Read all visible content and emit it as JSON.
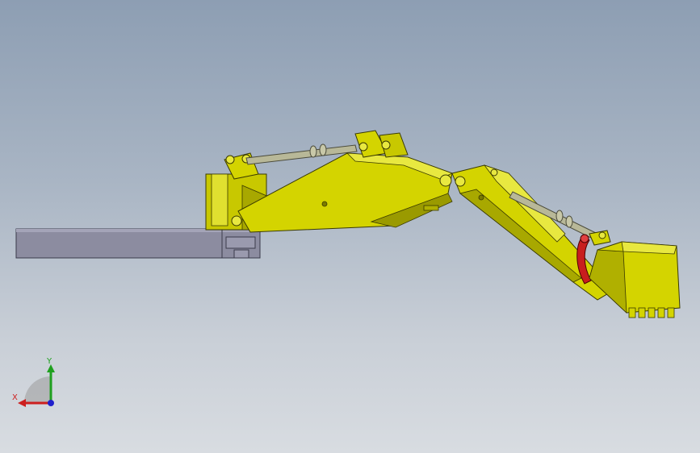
{
  "viewport": {
    "bg_top": "#8d9eb3",
    "bg_bottom": "#d8dce1"
  },
  "model": {
    "body_color": "#d4d400",
    "body_shadow": "#9a9a00",
    "body_light": "#e8e840",
    "base_color": "#8c8ca0",
    "cylinder_color": "#b8b898",
    "link_color": "#c81e1e"
  },
  "triad": {
    "x_label": "X",
    "y_label": "Y",
    "x_color": "#cc1f1f",
    "y_color": "#1fa01f",
    "z_color": "#1f1fcc"
  }
}
